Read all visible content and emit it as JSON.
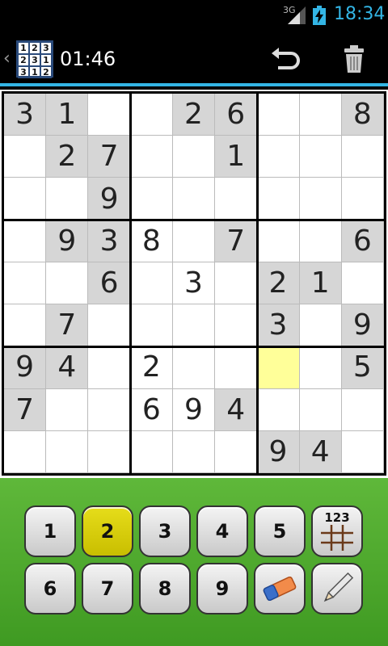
{
  "status_bar": {
    "network": "3G",
    "time": "18:34",
    "accent_color": "#33b5e5"
  },
  "action_bar": {
    "up_caret": "‹",
    "app_icon_digits": [
      "1",
      "2",
      "3",
      "2",
      "3",
      "1",
      "3",
      "1",
      "2"
    ],
    "timer": "01:46",
    "undo_icon": "undo-icon",
    "trash_icon": "trash-icon"
  },
  "board": {
    "rows": [
      [
        "3",
        "1",
        "",
        "",
        "2",
        "6",
        "",
        "",
        "8"
      ],
      [
        "",
        "2",
        "7",
        "",
        "",
        "1",
        "",
        "",
        ""
      ],
      [
        "",
        "",
        "9",
        "",
        "",
        "",
        "",
        "",
        ""
      ],
      [
        "",
        "9",
        "3",
        "8",
        "",
        "7",
        "",
        "",
        "6"
      ],
      [
        "",
        "",
        "6",
        "",
        "3",
        "",
        "2",
        "1",
        ""
      ],
      [
        "",
        "7",
        "",
        "",
        "",
        "",
        "3",
        "",
        "9"
      ],
      [
        "9",
        "4",
        "",
        "2",
        "",
        "",
        "",
        "",
        "5"
      ],
      [
        "7",
        "",
        "",
        "6",
        "9",
        "4",
        "",
        "",
        ""
      ],
      [
        "",
        "",
        "",
        "",
        "",
        "",
        "9",
        "4",
        ""
      ]
    ],
    "given": [
      [
        1,
        1,
        0,
        0,
        1,
        1,
        0,
        0,
        1
      ],
      [
        0,
        1,
        1,
        0,
        0,
        1,
        0,
        0,
        0
      ],
      [
        0,
        0,
        1,
        0,
        0,
        0,
        0,
        0,
        0
      ],
      [
        0,
        1,
        1,
        0,
        0,
        1,
        0,
        0,
        1
      ],
      [
        0,
        0,
        1,
        0,
        0,
        0,
        1,
        1,
        0
      ],
      [
        0,
        1,
        0,
        0,
        0,
        0,
        1,
        0,
        1
      ],
      [
        1,
        1,
        0,
        0,
        0,
        0,
        0,
        0,
        1
      ],
      [
        1,
        0,
        0,
        0,
        0,
        1,
        0,
        0,
        0
      ],
      [
        0,
        0,
        0,
        0,
        0,
        0,
        1,
        1,
        0
      ]
    ],
    "selected": {
      "row": 6,
      "col": 6
    },
    "given_color": "#d6d6d6",
    "selected_color": "#ffff99"
  },
  "keypad": {
    "keys": [
      "1",
      "2",
      "3",
      "4",
      "5",
      "",
      "6",
      "7",
      "8",
      "9",
      "",
      ""
    ],
    "active_key": "2",
    "notes_grid_label": "123",
    "active_color": "#d9ce00",
    "background_color": "#4fab2d"
  }
}
